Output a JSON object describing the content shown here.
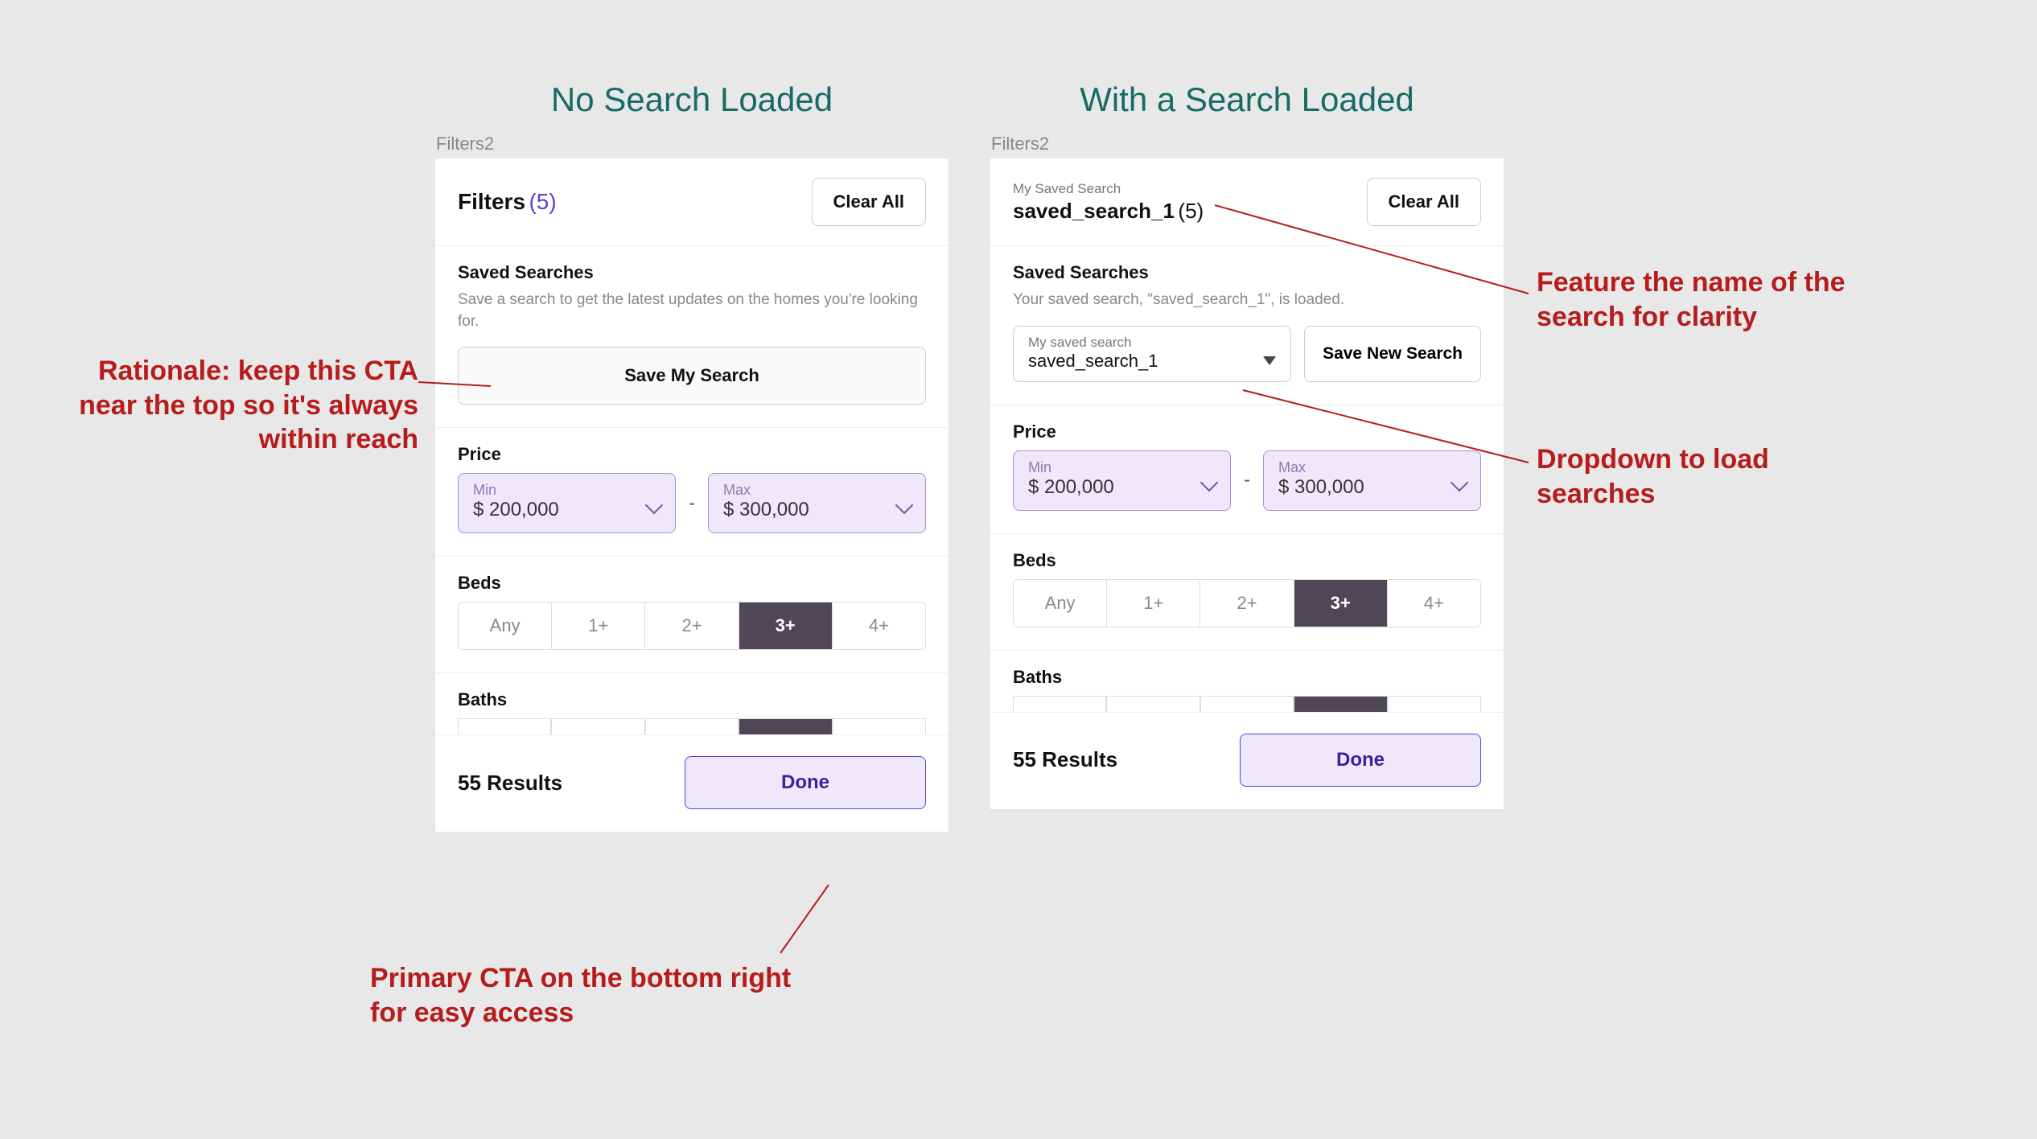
{
  "titles": {
    "left": "No Search Loaded",
    "right": "With a Search Loaded"
  },
  "frame_label": "Filters2",
  "left": {
    "header": {
      "title": "Filters",
      "count": "(5)",
      "clear": "Clear All"
    },
    "saved": {
      "title": "Saved Searches",
      "sub": "Save a search to get the latest updates on the homes you're looking for.",
      "cta": "Save My Search"
    }
  },
  "right": {
    "header": {
      "mysaved_label": "My Saved Search",
      "name": "saved_search_1",
      "count": "(5)",
      "clear": "Clear All"
    },
    "saved": {
      "title": "Saved Searches",
      "sub": "Your saved search, \"saved_search_1\", is loaded.",
      "dropdown_label": "My saved search",
      "dropdown_value": "saved_search_1",
      "save_new": "Save New Search"
    }
  },
  "price": {
    "title": "Price",
    "min_label": "Min",
    "min_value": "$ 200,000",
    "max_label": "Max",
    "max_value": "$ 300,000",
    "dash": "-"
  },
  "beds": {
    "title": "Beds",
    "options": [
      "Any",
      "1+",
      "2+",
      "3+",
      "4+"
    ],
    "selected": "3+"
  },
  "baths": {
    "title": "Baths"
  },
  "footer": {
    "results": "55 Results",
    "done": "Done"
  },
  "annotations": {
    "cta_top": "Rationale: keep this CTA near the top so it's always within reach",
    "cta_bottom": "Primary CTA on the bottom right for easy access",
    "name_clarity": "Feature the name of the search for clarity",
    "dropdown": "Dropdown to load searches"
  }
}
